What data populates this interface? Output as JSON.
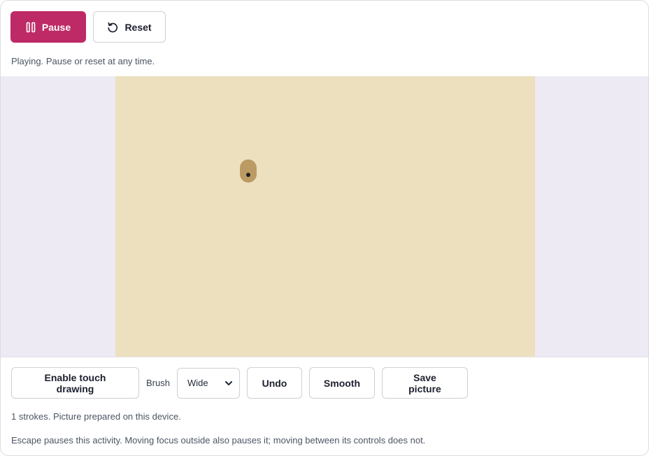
{
  "controls": {
    "pause_label": "Pause",
    "reset_label": "Reset"
  },
  "status": "Playing. Pause or reset at any time.",
  "canvas": {
    "background_color": "#ede0bf",
    "stroke_color": "#bb9a64",
    "stroke_count": 1
  },
  "toolbar": {
    "touch_label": "Enable touch drawing",
    "brush_label": "Brush",
    "brush_value": "Wide",
    "undo_label": "Undo",
    "smooth_label": "Smooth",
    "save_label": "Save picture"
  },
  "info": "1 strokes. Picture prepared on this device.",
  "hint": "Escape pauses this activity. Moving focus outside also pauses it; moving between its controls does not.",
  "colors": {
    "accent": "#be2a66",
    "stage_background": "#edeaf4"
  }
}
